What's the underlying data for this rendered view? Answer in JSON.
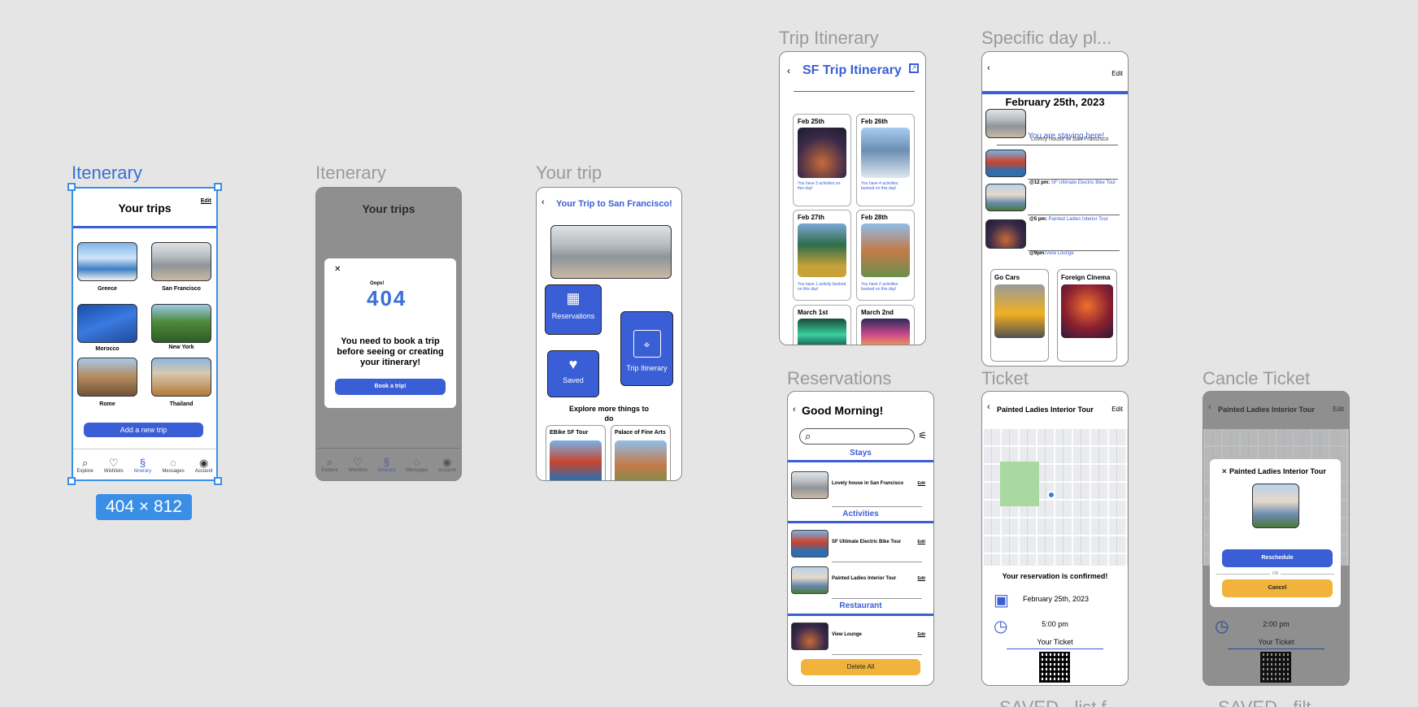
{
  "frame_labels": {
    "itinerary_selected": "Itenerary",
    "itinerary_empty": "Itenerary",
    "your_trip": "Your trip",
    "trip_itinerary": "Trip Itinerary",
    "specific_day": "Specific day pl...",
    "reservations": "Reservations",
    "ticket": "Ticket",
    "cancel_ticket": "Cancle Ticket",
    "bottom_cut_1": "SAVED - list f",
    "bottom_cut_2": "SAVED - filt"
  },
  "selection_size": "404 × 812",
  "your_trips": {
    "title": "Your trips",
    "edit": "Edit",
    "destinations": [
      "Greece",
      "San Francisco",
      "Morocco",
      "New York",
      "Rome",
      "Thailand"
    ],
    "add_button": "Add a new trip",
    "nav": [
      "Explore",
      "Wishlists",
      "Itinerary",
      "Messages",
      "Account"
    ]
  },
  "empty_itinerary": {
    "title": "Your trips",
    "close": "✕",
    "oops": "Oops!",
    "error_code": "404",
    "message": "You need to book a trip before seeing or creating your itinerary!",
    "button": "Book a trip!",
    "nav": [
      "Explore",
      "Wishlists",
      "Itinerary",
      "Messages",
      "Account"
    ]
  },
  "trip": {
    "back": "‹",
    "title": "Your Trip to San Francisco!",
    "tiles": [
      "Reservations",
      "Saved",
      "Trip Itinerary"
    ],
    "explore_heading": "Explore more things to do",
    "cards": [
      "EBike SF Tour",
      "Palace of Fine Arts"
    ]
  },
  "trip_itinerary": {
    "back": "‹",
    "title": "SF Trip Itinerary",
    "days": [
      {
        "date": "Feb 25th",
        "note": "You have 3 activities on this day!"
      },
      {
        "date": "Feb 26th",
        "note": "You have 4 activities booked on this day!"
      },
      {
        "date": "Feb 27th",
        "note": "You have 1 activity booked on this day!"
      },
      {
        "date": "Feb 28th",
        "note": "You have 2 activities booked on this day!"
      },
      {
        "date": "March 1st",
        "note": ""
      },
      {
        "date": "March 2nd",
        "note": ""
      }
    ]
  },
  "specific_day": {
    "back": "‹",
    "edit": "Edit",
    "date": "February 25th, 2023",
    "staying": "You are staying here!",
    "staying_sub": "Lovely house in San Francisco",
    "items": [
      {
        "time": "@12 pm:",
        "name": "SF Ultimate Electric Bike Tour"
      },
      {
        "time": "@5 pm:",
        "name": "Painted Ladies Interior Tour"
      },
      {
        "time": "@9pm:",
        "name": "View Lounge"
      }
    ],
    "suggestions": [
      "Go Cars",
      "Foreign Cinema"
    ]
  },
  "reservations": {
    "back": "‹",
    "greeting": "Good Morning!",
    "sections": [
      "Stays",
      "Activities",
      "Restaurant"
    ],
    "stays": [
      "Lovely house in San Francisco"
    ],
    "activities": [
      "SF Ultimate Electric Bike Tour",
      "Painted Ladies Interior Tour"
    ],
    "restaurants": [
      "View Lounge"
    ],
    "edit": "Edit",
    "delete_all": "Delete All"
  },
  "ticket": {
    "back": "‹",
    "title": "Painted Ladies Interior Tour",
    "edit": "Edit",
    "confirmed": "Your reservation is confirmed!",
    "date": "February 25th, 2023",
    "time": "5:00 pm",
    "your_ticket": "Your Ticket"
  },
  "cancel_ticket": {
    "header": "Painted Ladies Interior Tour",
    "edit": "Edit",
    "modal_title": "Painted Ladies Interior Tour",
    "close": "✕",
    "reschedule": "Reschedule",
    "or": "OR",
    "cancel": "Cancel",
    "time": "2:00 pm",
    "your_ticket": "Your Ticket"
  },
  "colors": {
    "accent": "#3a5ed6",
    "yellow": "#f2b33c",
    "canvas": "#e5e5e5",
    "selection": "#3a8ee6"
  }
}
